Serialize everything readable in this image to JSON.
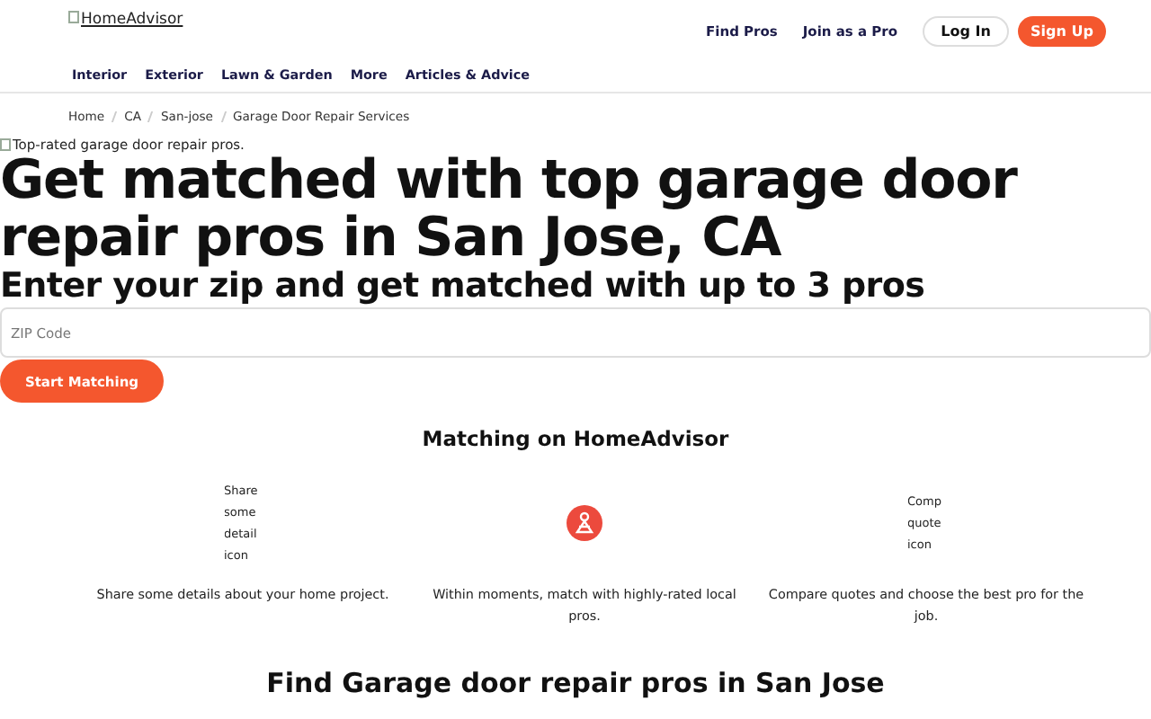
{
  "header": {
    "logo_alt": "HomeAdvisor",
    "links": [
      "Find Pros",
      "Join as a Pro"
    ],
    "login": "Log In",
    "signup": "Sign Up"
  },
  "nav": [
    "Interior",
    "Exterior",
    "Lawn & Garden",
    "More",
    "Articles & Advice"
  ],
  "breadcrumbs": [
    "Home",
    "CA",
    "San-jose",
    "Garage Door Repair Services"
  ],
  "hero": {
    "image_alt": "Top-rated garage door repair pros.",
    "title": "Get matched with top garage door repair pros in San Jose, CA",
    "subtitle": "Enter your zip and get matched with up to 3 pros",
    "zip": {
      "placeholder": "ZIP Code"
    },
    "button": "Start Matching"
  },
  "matching": {
    "title": "Matching on HomeAdvisor",
    "steps": [
      {
        "kind": "broken",
        "alt": "Share some detail icon",
        "text": "Share some details about your home project."
      },
      {
        "kind": "icon",
        "text": "Within moments, match with highly-rated local pros."
      },
      {
        "kind": "broken",
        "alt": "Comp quote icon",
        "text": "Compare quotes and choose the best pro for the job."
      }
    ]
  },
  "find_title": "Find Garage door repair pros in San Jose"
}
